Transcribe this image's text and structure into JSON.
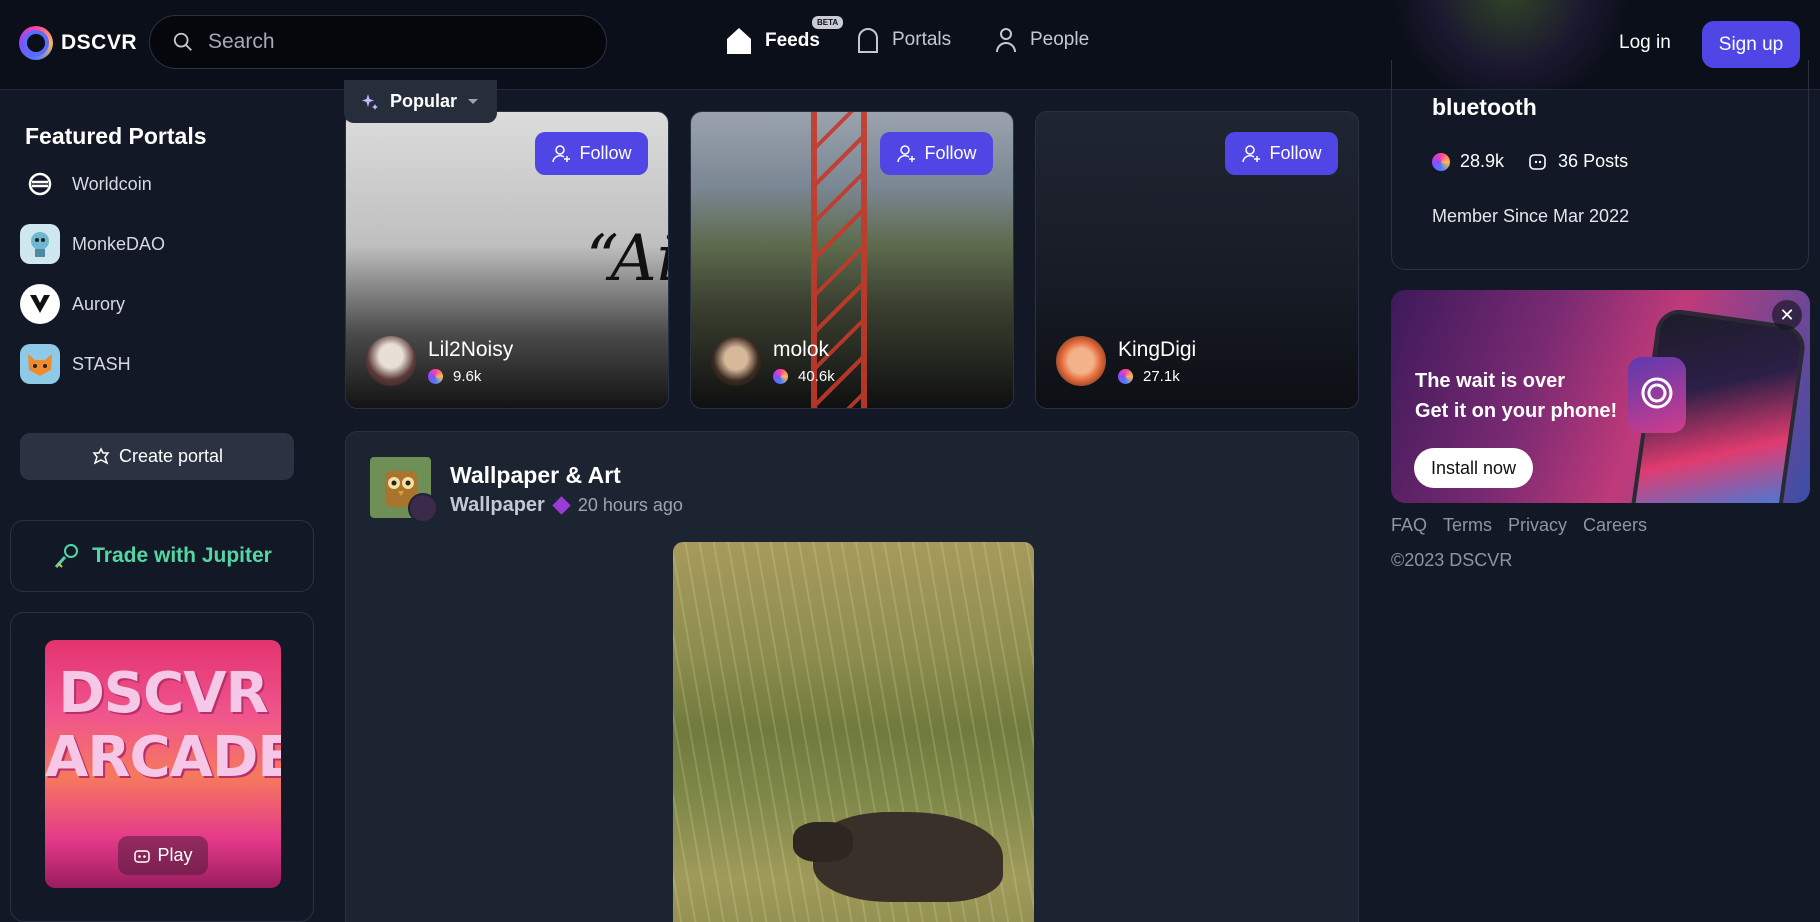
{
  "header": {
    "brand": "DSCVR",
    "search_placeholder": "Search",
    "nav": {
      "feeds": "Feeds",
      "beta": "BETA",
      "portals": "Portals",
      "people": "People"
    },
    "login": "Log in",
    "signup": "Sign up"
  },
  "sidebar": {
    "featured_title": "Featured Portals",
    "portals": [
      {
        "label": "Worldcoin"
      },
      {
        "label": "MonkeDAO"
      },
      {
        "label": "Aurory"
      },
      {
        "label": "STASH"
      }
    ],
    "create_portal": "Create portal",
    "jupiter": "Trade with Jupiter",
    "arcade": {
      "line1": "DSCVR",
      "line2": "ARCADE",
      "play": "Play"
    }
  },
  "popular": {
    "tab_label": "Popular",
    "cards": [
      {
        "name": "Lil2Noisy",
        "stat": "9.6k",
        "follow": "Follow"
      },
      {
        "name": "molok",
        "stat": "40.6k",
        "follow": "Follow"
      },
      {
        "name": "KingDigi",
        "stat": "27.1k",
        "follow": "Follow"
      }
    ]
  },
  "post": {
    "title": "Wallpaper & Art",
    "portal": "Wallpaper",
    "time": "20 hours ago"
  },
  "profile": {
    "name": "bluetooth",
    "followers": "28.9k",
    "posts": "36 Posts",
    "member_since": "Member Since Mar 2022"
  },
  "promo": {
    "line1": "The wait is over",
    "line2": "Get it on your phone!",
    "install": "Install now"
  },
  "footer": {
    "links": [
      "FAQ",
      "Terms",
      "Privacy",
      "Careers"
    ],
    "copyright": "©2023 DSCVR"
  },
  "colors": {
    "accent": "#4f46e5",
    "background": "#121826",
    "header": "#0b0f19",
    "jupiter": "#53d6a4"
  }
}
